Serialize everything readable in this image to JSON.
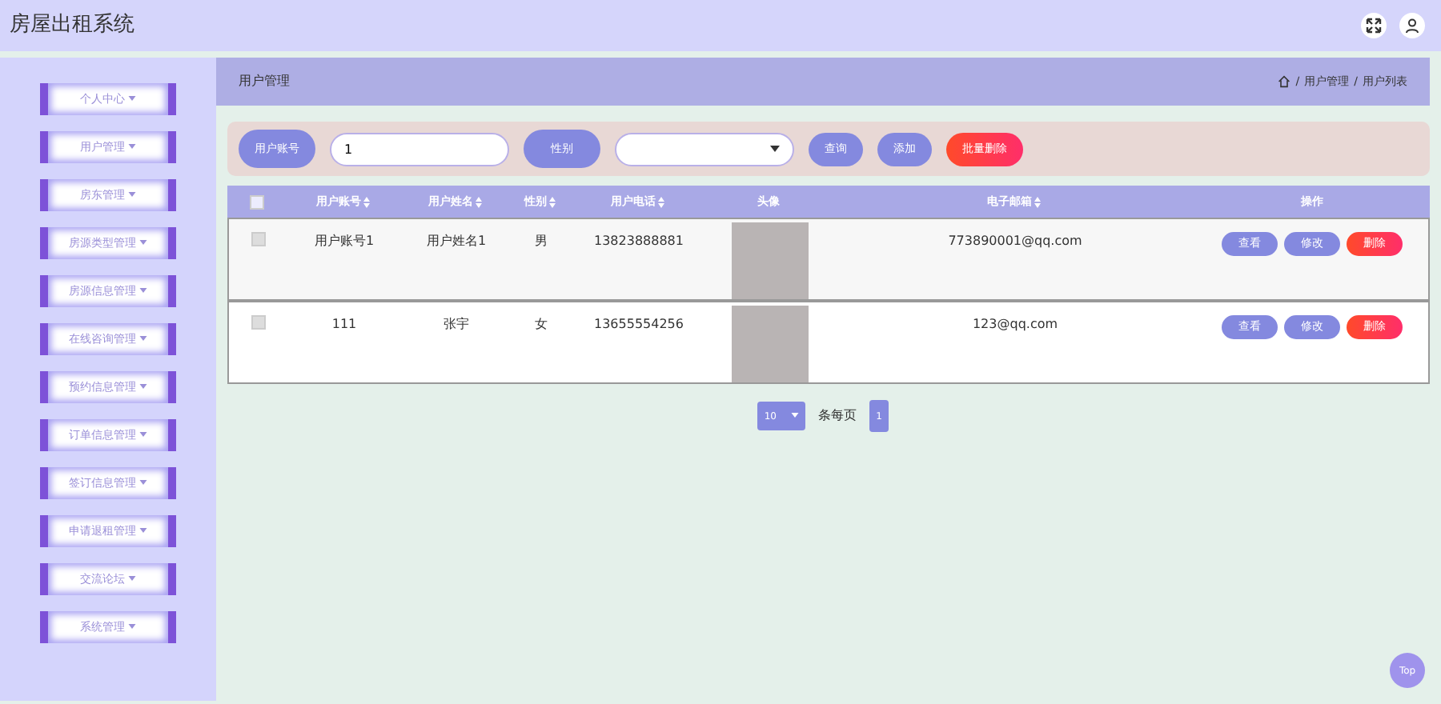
{
  "header": {
    "title": "房屋出租系统"
  },
  "sidebar": {
    "items": [
      {
        "label": "个人中心"
      },
      {
        "label": "用户管理"
      },
      {
        "label": "房东管理"
      },
      {
        "label": "房源类型管理"
      },
      {
        "label": "房源信息管理"
      },
      {
        "label": "在线咨询管理"
      },
      {
        "label": "预约信息管理"
      },
      {
        "label": "订单信息管理"
      },
      {
        "label": "签订信息管理"
      },
      {
        "label": "申请退租管理"
      },
      {
        "label": "交流论坛"
      },
      {
        "label": "系统管理"
      }
    ]
  },
  "page_header": {
    "title": "用户管理",
    "breadcrumb": [
      {
        "separator": "/",
        "label": "用户管理"
      },
      {
        "separator": "/",
        "label": "用户列表"
      }
    ]
  },
  "search": {
    "account_label": "用户账号",
    "account_value": "1",
    "gender_label": "性别",
    "buttons": [
      {
        "label": "查询",
        "kind": "primary"
      },
      {
        "label": "添加",
        "kind": "primary"
      },
      {
        "label": "批量删除",
        "kind": "danger"
      }
    ]
  },
  "table": {
    "all_checked": false,
    "columns": [
      {
        "label": "用户账号",
        "sortable": true
      },
      {
        "label": "用户姓名",
        "sortable": true
      },
      {
        "label": "性别",
        "sortable": true
      },
      {
        "label": "用户电话",
        "sortable": true
      },
      {
        "label": "头像",
        "sortable": false
      },
      {
        "label": "电子邮箱",
        "sortable": true
      },
      {
        "label": "操作",
        "sortable": false
      }
    ],
    "rows": [
      {
        "checked": false,
        "cells": [
          "用户账号1",
          "用户姓名1",
          "男",
          "13823888881",
          "773890001@qq.com"
        ],
        "actions": [
          {
            "label": "查看",
            "kind": "primary"
          },
          {
            "label": "修改",
            "kind": "primary"
          },
          {
            "label": "删除",
            "kind": "danger"
          }
        ]
      },
      {
        "checked": false,
        "cells": [
          "111",
          "张宇",
          "女",
          "13655554256",
          "123@qq.com"
        ],
        "actions": [
          {
            "label": "查看",
            "kind": "primary"
          },
          {
            "label": "修改",
            "kind": "primary"
          },
          {
            "label": "删除",
            "kind": "danger"
          }
        ]
      }
    ]
  },
  "pagination": {
    "page_size": "10",
    "per_page_label": "条每页",
    "pages": [
      {
        "label": "1",
        "selected": true
      }
    ]
  },
  "back_to_top": "Top"
}
